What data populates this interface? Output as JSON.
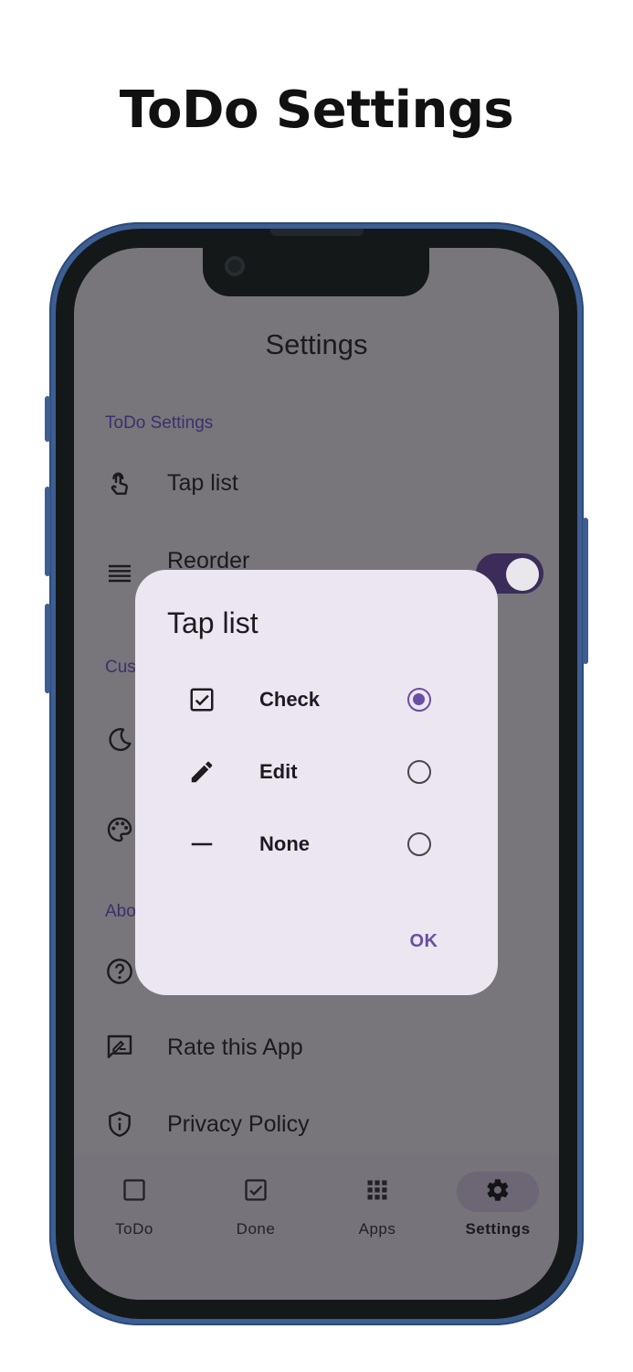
{
  "promo": {
    "title": "ToDo Settings"
  },
  "screen": {
    "title": "Settings",
    "sections": [
      {
        "label": "ToDo Settings",
        "visible_text": "ToDo Settings"
      },
      {
        "label_partial": "Cus"
      },
      {
        "label_partial": "Abo"
      }
    ],
    "rows": {
      "tap_list": {
        "label": "Tap list",
        "icon": "touch-icon"
      },
      "reorder": {
        "label": "Reorder",
        "icon": "reorder-icon",
        "toggle_on": true
      },
      "dark_mode": {
        "icon": "moon-icon"
      },
      "theme": {
        "icon": "palette-icon"
      },
      "help": {
        "icon": "help-icon"
      },
      "rate": {
        "label": "Rate this App",
        "icon": "rate-review-icon"
      },
      "privacy": {
        "label": "Privacy Policy",
        "icon": "shield-icon"
      }
    },
    "bottom_nav": {
      "items": [
        {
          "label": "ToDo",
          "icon": "checkbox-blank-icon"
        },
        {
          "label": "Done",
          "icon": "checkbox-checked-icon"
        },
        {
          "label": "Apps",
          "icon": "apps-grid-icon"
        },
        {
          "label": "Settings",
          "icon": "gear-icon",
          "active": true
        }
      ]
    }
  },
  "dialog": {
    "title": "Tap list",
    "options": [
      {
        "label": "Check",
        "icon": "checkbox-checked-icon",
        "selected": true
      },
      {
        "label": "Edit",
        "icon": "pencil-icon",
        "selected": false
      },
      {
        "label": "None",
        "icon": "dash-icon",
        "selected": false
      }
    ],
    "ok_label": "OK"
  },
  "colors": {
    "accent": "#6750a4",
    "phone_frame": "#3d5e92",
    "dialog_bg": "#ece6f1",
    "toggle_track": "#3b2c5a"
  }
}
